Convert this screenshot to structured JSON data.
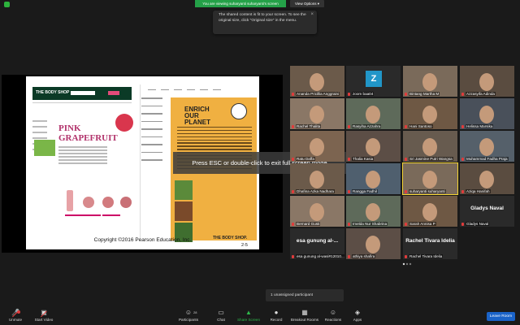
{
  "top": {
    "viewing_banner": "You are viewing suharyanti suharyanti's screen",
    "view_options": "View Options ▾",
    "tooltip": "The shared content is fit to your screen. To see the original size, click \"Original size\" in the menu.",
    "tooltip_close": "×"
  },
  "share": {
    "shop_name": "THE BODY SHOP",
    "pink_title": "PINK GRAPEFRUIT",
    "planet_title": "ENRICH OUR PLANET",
    "body_shop_foot": "THE BODY SHOP.",
    "copyright": "Copyright ©2016 Pearson Education, Inc.",
    "page_number": "2-5",
    "exit_banner": "Press ESC or double-click to exit full screen mode"
  },
  "gallery": {
    "tiles": [
      {
        "name": "Ananda Pricillia Anggraini",
        "type": "video"
      },
      {
        "name": "zoom baa04",
        "type": "avatar",
        "avatar_letter": "Z"
      },
      {
        "name": "Bintang Martha M",
        "type": "video"
      },
      {
        "name": "Azzasyifa Adinda",
        "type": "video"
      },
      {
        "name": "Rachel Thalita",
        "type": "video"
      },
      {
        "name": "Rasyiha Azzahra",
        "type": "video"
      },
      {
        "name": "Hani Santoso",
        "type": "video"
      },
      {
        "name": "Helissa Marsika",
        "type": "video"
      },
      {
        "name": "Ratu Daffa",
        "type": "video"
      },
      {
        "name": "Thalia Kasia",
        "type": "video"
      },
      {
        "name": "Sri Jasmine Putri Wangsa",
        "type": "video"
      },
      {
        "name": "Muhammad Fadha Praja",
        "type": "video"
      },
      {
        "name": "Dhafina Azka Nadhara",
        "type": "video"
      },
      {
        "name": "Rangga Fadhil",
        "type": "video"
      },
      {
        "name": "suharyanti suharyanti",
        "type": "video",
        "active": true
      },
      {
        "name": "Aziqa Hanifah",
        "type": "video"
      },
      {
        "name": "Bernard Gusti",
        "type": "video"
      },
      {
        "name": "Imelda Nur Shabrina",
        "type": "video"
      },
      {
        "name": "Sarah Annisa P",
        "type": "video"
      },
      {
        "name": "Gladys Naval",
        "type": "name",
        "big_name": "Gladys Naval"
      },
      {
        "name": "esa gunung al-wasi#12010...",
        "type": "name",
        "big_name": "esa gunung al-..."
      },
      {
        "name": "athiya shafira",
        "type": "video"
      },
      {
        "name": "Rachel Tivara Idelia",
        "type": "name",
        "big_name": "Rachel Tivara Idelia"
      }
    ]
  },
  "unassigned": "1 unassigned participant",
  "toolbar": {
    "unmute": "Unmute",
    "start_video": "Start Video",
    "participants": "Participants",
    "participants_count": "28",
    "chat": "Chat",
    "share_screen": "Share Screen",
    "record": "Record",
    "breakout_rooms": "Breakout Rooms",
    "reactions": "Reactions",
    "apps": "Apps",
    "leave_room": "Leave Room"
  },
  "colors": {
    "banner_green": "#24a148",
    "leave_blue": "#1a63c8",
    "active_outline": "#f5d533",
    "mute_red": "#e03b3b"
  }
}
